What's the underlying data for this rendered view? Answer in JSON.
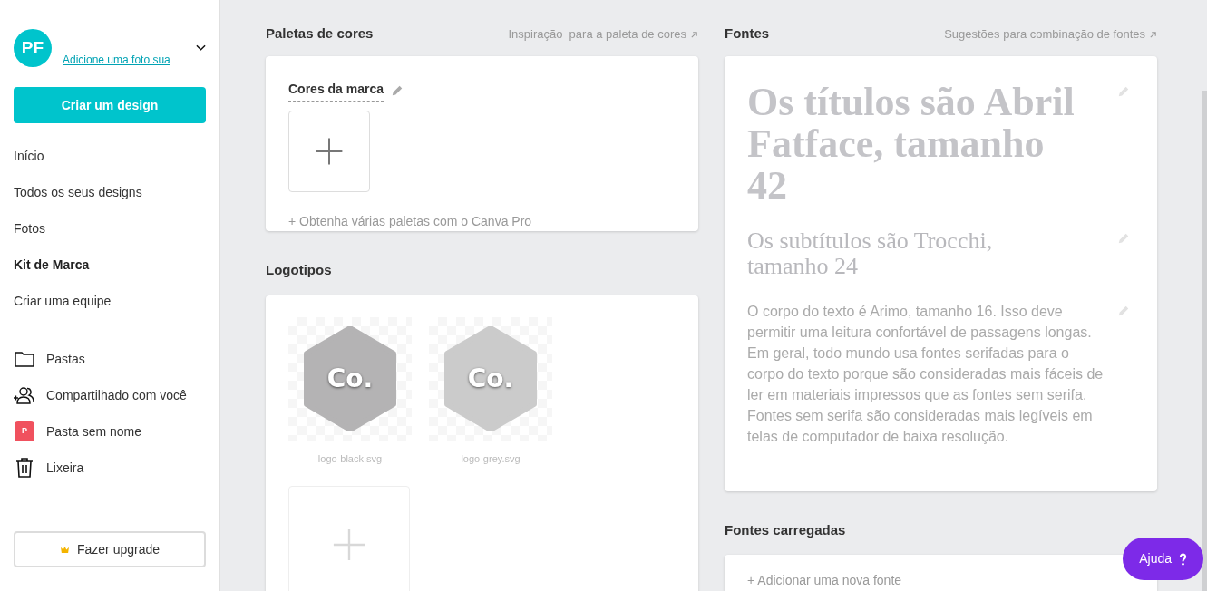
{
  "sidebar": {
    "avatar": "PF",
    "profile_link": "Adicione uma foto sua",
    "create_button": "Criar um design",
    "nav": [
      {
        "label": "Início",
        "selected": false
      },
      {
        "label": "Todos os seus designs",
        "selected": false
      },
      {
        "label": "Fotos",
        "selected": false
      },
      {
        "label": "Kit de Marca",
        "selected": true
      },
      {
        "label": "Criar uma equipe",
        "selected": false
      }
    ],
    "folders": [
      {
        "kind": "folder",
        "label": "Pastas"
      },
      {
        "kind": "shared",
        "label": "Compartilhado com você"
      },
      {
        "kind": "named",
        "label": "Pasta sem nome",
        "badge": "P",
        "color": "#f0515e"
      },
      {
        "kind": "trash",
        "label": "Lixeira"
      }
    ],
    "upgrade_button": "Fazer upgrade"
  },
  "palettes": {
    "title": "Paletas de cores",
    "link": "Inspiração  para a paleta de cores",
    "palette_name": "Cores da marca",
    "pro_link": "+ Obtenha várias paletas com o Canva Pro"
  },
  "logos": {
    "title": "Logotipos",
    "items": [
      {
        "mark": "Co.",
        "file": "logo-black.svg",
        "color": "#b4b3b4"
      },
      {
        "mark": "Co.",
        "file": "logo-grey.svg",
        "color": "#cbcbcb"
      }
    ]
  },
  "fonts": {
    "title": "Fontes",
    "link": "Sugestões para combinação de fontes",
    "samples": [
      {
        "kind": "heading",
        "text": "Os títulos são Abril Fatface, tamanho 42"
      },
      {
        "kind": "subheading",
        "text": "Os subtítulos são Trocchi, tamanho 24"
      },
      {
        "kind": "body",
        "text": "O corpo do texto é Arimo, tamanho 16. Isso deve permitir uma leitura confortável de passagens longas. Em geral, todo mundo usa fontes serifadas para o corpo do texto porque são consideradas mais fáceis de ler em materiais impressos que as  fontes sem serifa. Fontes sem serifa  são  consideradas mais  legíveis  em  telas de computador de baixa resolução."
      }
    ]
  },
  "uploaded_fonts": {
    "title": "Fontes carregadas",
    "placeholder": "+ Adicionar uma nova fonte"
  },
  "help_button": "Ajuda"
}
